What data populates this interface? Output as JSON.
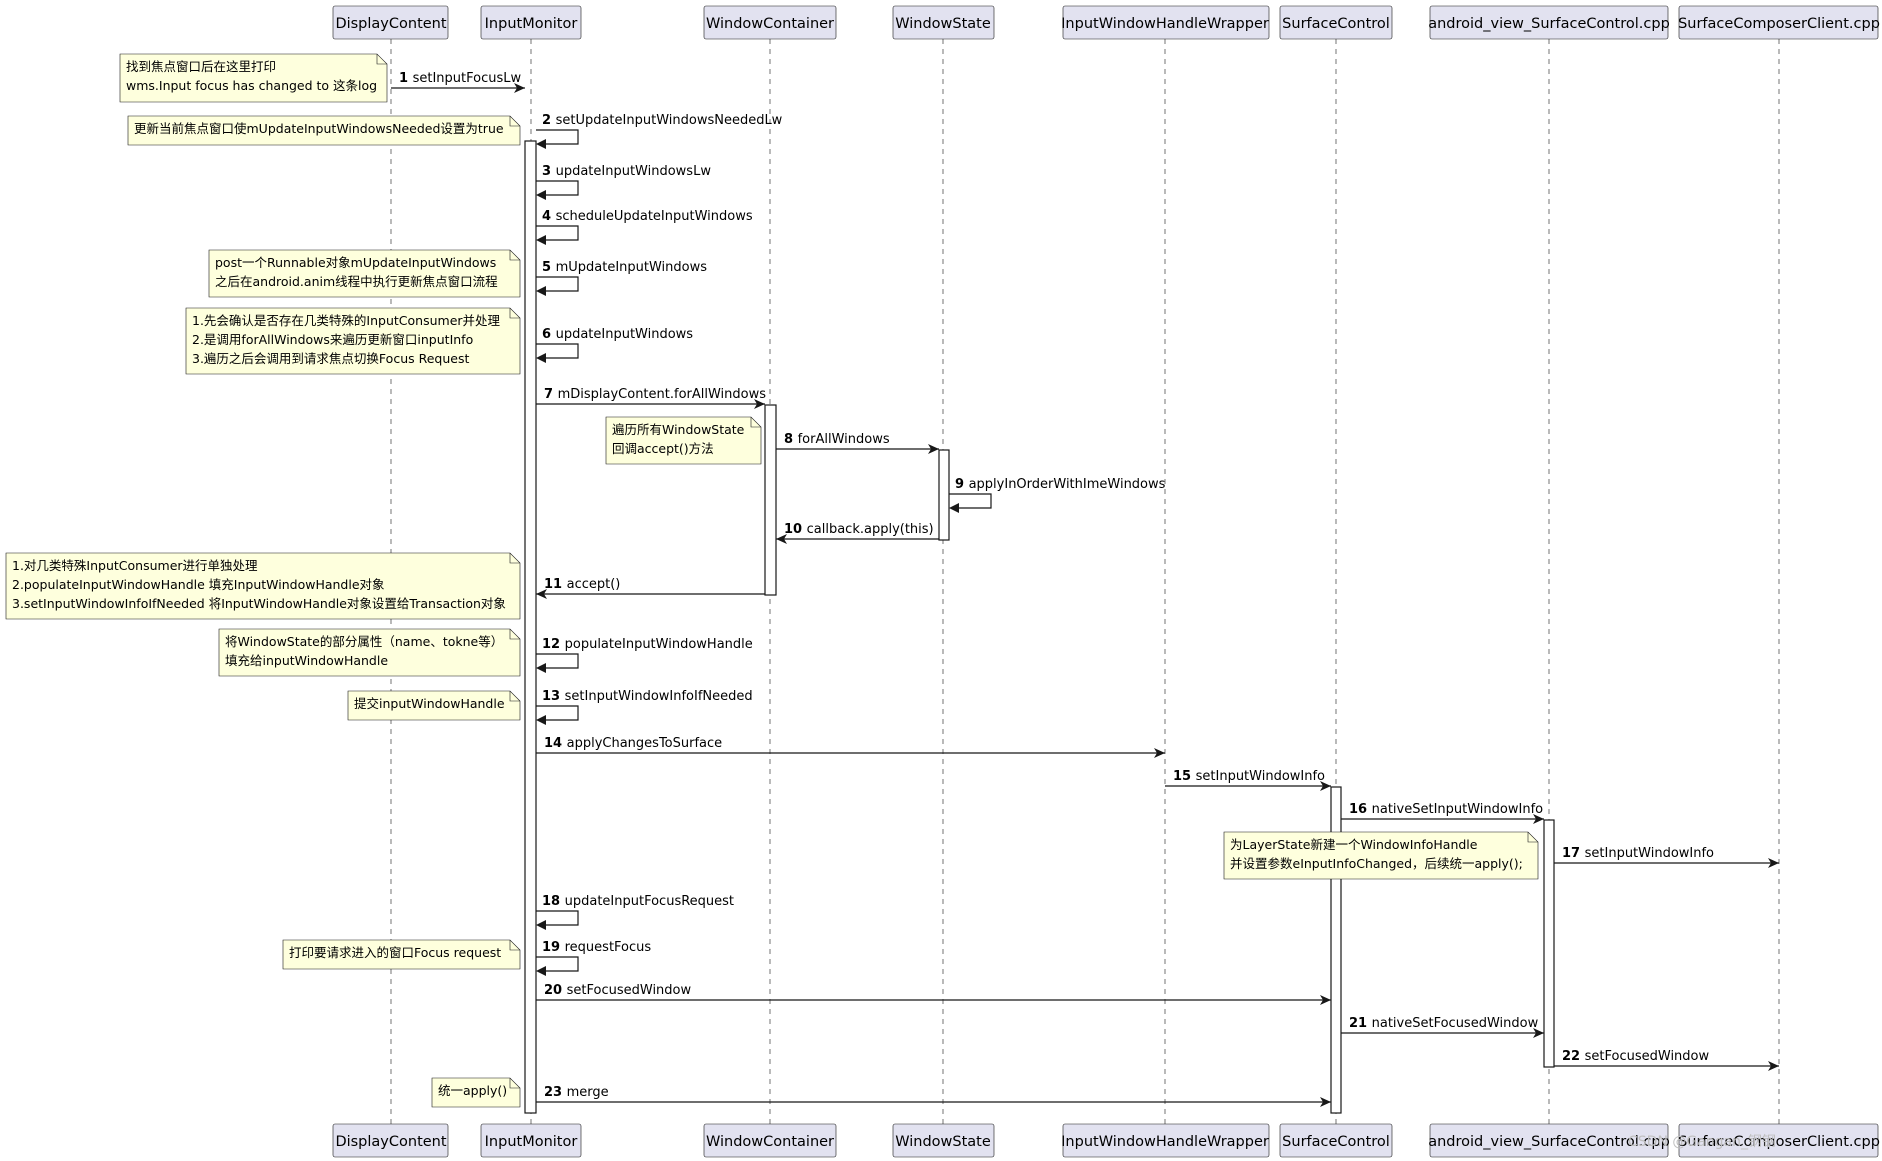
{
  "participants": [
    "DisplayContent",
    "InputMonitor",
    "WindowContainer",
    "WindowState",
    "InputWindowHandleWrapper",
    "SurfaceControl",
    "android_view_SurfaceControl.cpp",
    "SurfaceComposerClient.cpp"
  ],
  "messages": [
    {
      "n": "1",
      "text": "setInputFocusLw"
    },
    {
      "n": "2",
      "text": "setUpdateInputWindowsNeededLw"
    },
    {
      "n": "3",
      "text": "updateInputWindowsLw"
    },
    {
      "n": "4",
      "text": "scheduleUpdateInputWindows"
    },
    {
      "n": "5",
      "text": "mUpdateInputWindows"
    },
    {
      "n": "6",
      "text": "updateInputWindows"
    },
    {
      "n": "7",
      "text": "mDisplayContent.forAllWindows"
    },
    {
      "n": "8",
      "text": "forAllWindows"
    },
    {
      "n": "9",
      "text": "applyInOrderWithImeWindows"
    },
    {
      "n": "10",
      "text": "callback.apply(this)"
    },
    {
      "n": "11",
      "text": "accept()"
    },
    {
      "n": "12",
      "text": "populateInputWindowHandle"
    },
    {
      "n": "13",
      "text": "setInputWindowInfoIfNeeded"
    },
    {
      "n": "14",
      "text": "applyChangesToSurface"
    },
    {
      "n": "15",
      "text": "setInputWindowInfo"
    },
    {
      "n": "16",
      "text": "nativeSetInputWindowInfo"
    },
    {
      "n": "17",
      "text": "setInputWindowInfo"
    },
    {
      "n": "18",
      "text": "updateInputFocusRequest"
    },
    {
      "n": "19",
      "text": "requestFocus"
    },
    {
      "n": "20",
      "text": "setFocusedWindow"
    },
    {
      "n": "21",
      "text": "nativeSetFocusedWindow"
    },
    {
      "n": "22",
      "text": "setFocusedWindow"
    },
    {
      "n": "23",
      "text": "merge"
    }
  ],
  "notes": [
    {
      "lines": [
        "找到焦点窗口后在这里打印",
        "wms.Input focus has changed to 这条log"
      ]
    },
    {
      "lines": [
        "更新当前焦点窗口使mUpdateInputWindowsNeeded设置为true"
      ]
    },
    {
      "lines": [
        "post一个Runnable对象mUpdateInputWindows",
        "之后在android.anim线程中执行更新焦点窗口流程"
      ]
    },
    {
      "lines": [
        "1.先会确认是否存在几类特殊的InputConsumer并处理",
        "2.是调用forAllWindows来遍历更新窗口inputInfo",
        "3.遍历之后会调用到请求焦点切换Focus Request"
      ]
    },
    {
      "lines": [
        "遍历所有WindowState",
        "回调accept()方法"
      ]
    },
    {
      "lines": [
        "1.对几类特殊InputConsumer进行单独处理",
        "2.populateInputWindowHandle 填充InputWindowHandle对象",
        "3.setInputWindowInfoIfNeeded 将InputWindowHandle对象设置给Transaction对象"
      ]
    },
    {
      "lines": [
        "将WindowState的部分属性（name、tokne等）",
        "填充给inputWindowHandle"
      ]
    },
    {
      "lines": [
        "提交inputWindowHandle"
      ]
    },
    {
      "lines": [
        "为LayerState新建一个WindowInfoHandle",
        "并设置参数eInputInfoChanged，后续统一apply();"
      ]
    },
    {
      "lines": [
        "打印要请求进入的窗口Focus request"
      ]
    },
    {
      "lines": [
        "统一apply()"
      ]
    }
  ],
  "watermark": "CSDN @Gangan_钢钢"
}
